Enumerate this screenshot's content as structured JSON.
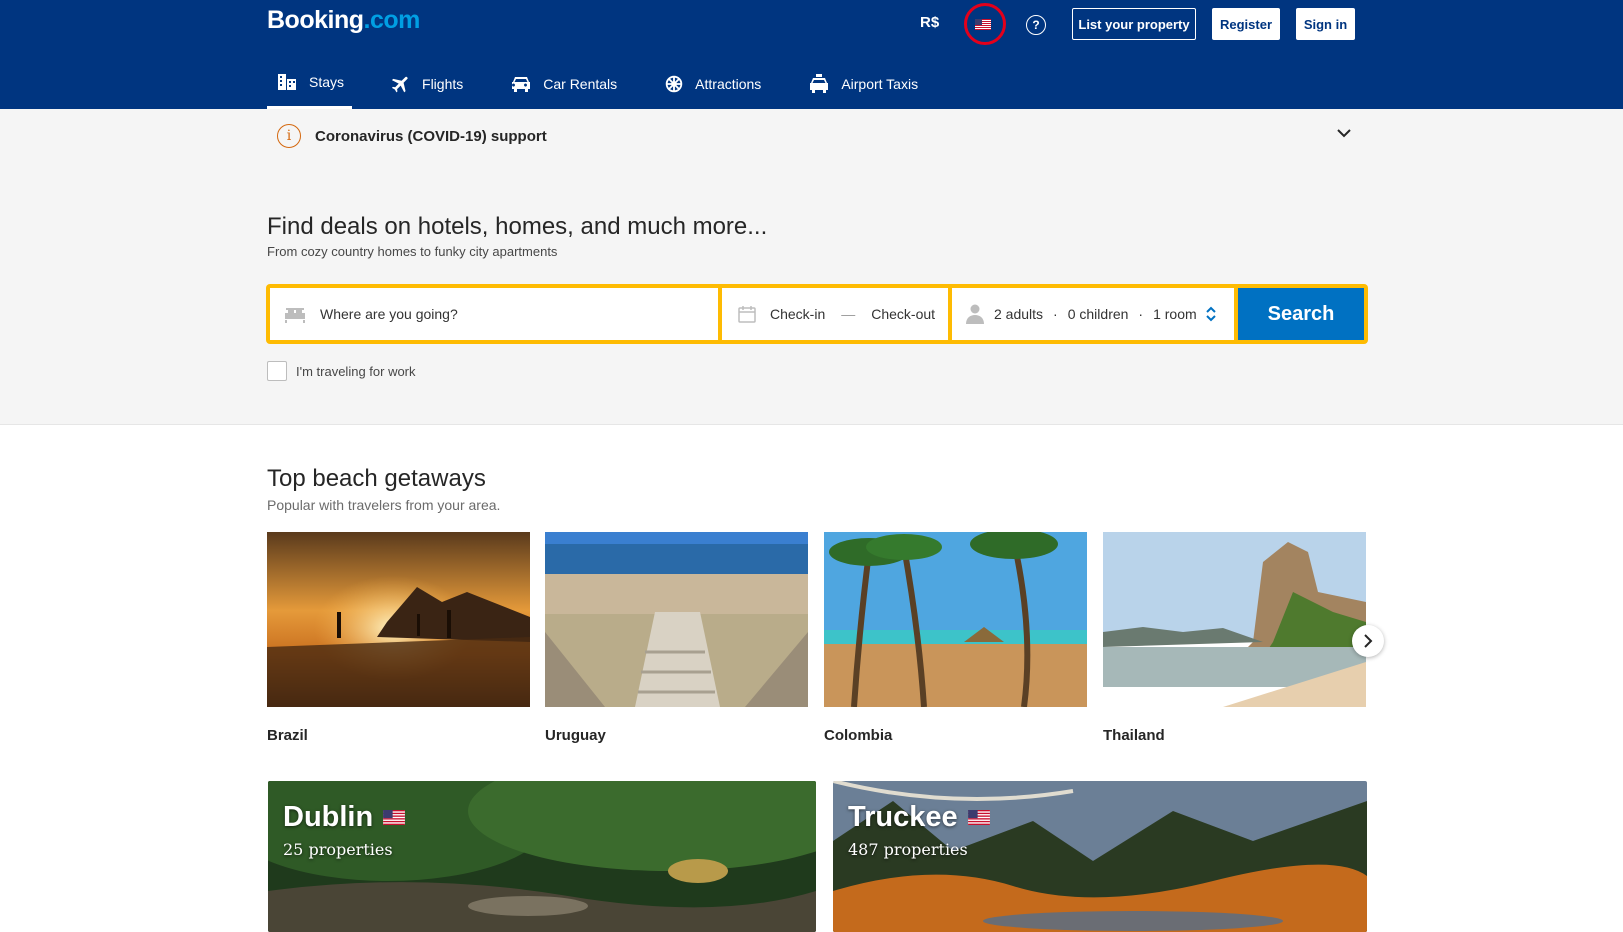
{
  "header": {
    "logo_main": "Booking",
    "logo_suffix": ".com",
    "currency": "R$",
    "help_symbol": "?",
    "list_property": "List your property",
    "register": "Register",
    "sign_in": "Sign in",
    "language_flag": "us-flag-icon"
  },
  "nav": {
    "items": [
      {
        "label": "Stays",
        "icon": "bed-icon",
        "active": true
      },
      {
        "label": "Flights",
        "icon": "airplane-icon"
      },
      {
        "label": "Car Rentals",
        "icon": "car-icon"
      },
      {
        "label": "Attractions",
        "icon": "attractions-icon"
      },
      {
        "label": "Airport Taxis",
        "icon": "taxi-icon"
      }
    ]
  },
  "covid": {
    "label": "Coronavirus (COVID-19) support",
    "info_symbol": "i"
  },
  "hero": {
    "title": "Find deals on hotels, homes, and much more...",
    "subtitle": "From cozy country homes to funky city apartments"
  },
  "search": {
    "destination_placeholder": "Where are you going?",
    "checkin": "Check-in",
    "dash": "—",
    "checkout": "Check-out",
    "adults": "2 adults",
    "children": "0 children",
    "rooms": "1 room",
    "separator": "·",
    "button": "Search",
    "work_label": "I'm traveling for work"
  },
  "beach": {
    "title": "Top beach getaways",
    "subtitle": "Popular with travelers from your area.",
    "items": [
      {
        "name": "Brazil"
      },
      {
        "name": "Uruguay"
      },
      {
        "name": "Colombia"
      },
      {
        "name": "Thailand"
      }
    ]
  },
  "destinations": [
    {
      "city": "Dublin",
      "properties": "25 properties"
    },
    {
      "city": "Truckee",
      "properties": "487 properties"
    }
  ],
  "colors": {
    "brand_blue": "#003580",
    "search_yellow": "#febb02",
    "button_blue": "#0071c2",
    "highlight_ring": "#e3001b"
  }
}
